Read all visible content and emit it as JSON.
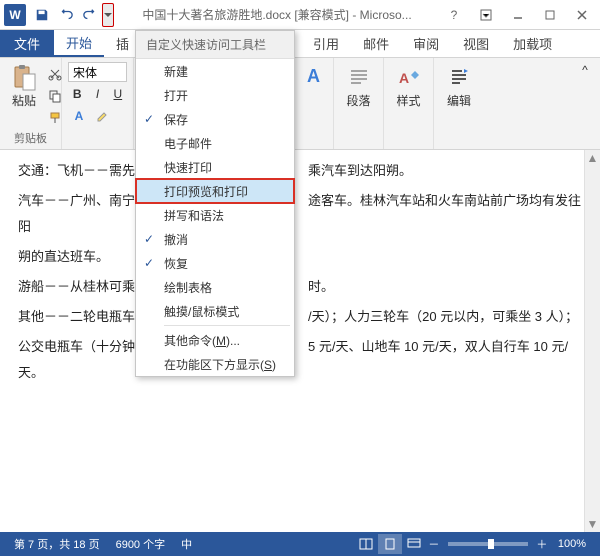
{
  "titlebar": {
    "app_icon_text": "W",
    "title": "中国十大著名旅游胜地.docx [兼容模式] - Microso..."
  },
  "tabs": {
    "file": "文件",
    "home": "开始",
    "insert_partial": "插",
    "references": "引用",
    "mailings": "邮件",
    "review": "审阅",
    "view": "视图",
    "addins": "加载项"
  },
  "ribbon": {
    "clipboard": {
      "paste": "粘贴",
      "group": "剪贴板"
    },
    "font": {
      "name": "宋体",
      "bold": "B",
      "italic": "I",
      "underline": "U"
    },
    "paragraph": {
      "label": "段落"
    },
    "styles": {
      "label": "样式"
    },
    "editing": {
      "label": "编辑"
    }
  },
  "qat_menu": {
    "header": "自定义快速访问工具栏",
    "items": [
      {
        "label": "新建",
        "checked": false
      },
      {
        "label": "打开",
        "checked": false
      },
      {
        "label": "保存",
        "checked": true
      },
      {
        "label": "电子邮件",
        "checked": false
      },
      {
        "label": "快速打印",
        "checked": false
      },
      {
        "label": "打印预览和打印",
        "checked": false,
        "highlight": true
      },
      {
        "label": "拼写和语法",
        "checked": false
      },
      {
        "label": "撤消",
        "checked": true
      },
      {
        "label": "恢复",
        "checked": true
      },
      {
        "label": "绘制表格",
        "checked": false
      },
      {
        "label": "触摸/鼠标模式",
        "checked": false
      }
    ],
    "more": "其他命令(M)...",
    "below": "在功能区下方显示(S)"
  },
  "document": {
    "line1_label": "交通：",
    "line1_text": "飞机－－需先乘",
    "line1_tail": "乘汽车到达阳朔。",
    "line2": "汽车－－广州、南宁、",
    "line2_tail": "途客车。桂林汽车站和火车南站前广场均有发往阳",
    "line3": "朔的直达班车。",
    "line4": "游船－－从桂林可乘坐",
    "line4_tail": "时。",
    "line5": "其他－－二轮电瓶车（",
    "line5_tail": "/天）；人力三轮车（20 元以内，可乘坐 3 人）；",
    "line6": "公交电瓶车（十分钟一",
    "line6_tail": "5 元/天、山地车 10 元/天，双人自行车 10 元/天。"
  },
  "statusbar": {
    "page": "第 7 页，共 18 页",
    "words": "6900 个字",
    "lang": "中",
    "zoom_minus": "－",
    "zoom_plus": "＋",
    "zoom_pct": "100%"
  }
}
